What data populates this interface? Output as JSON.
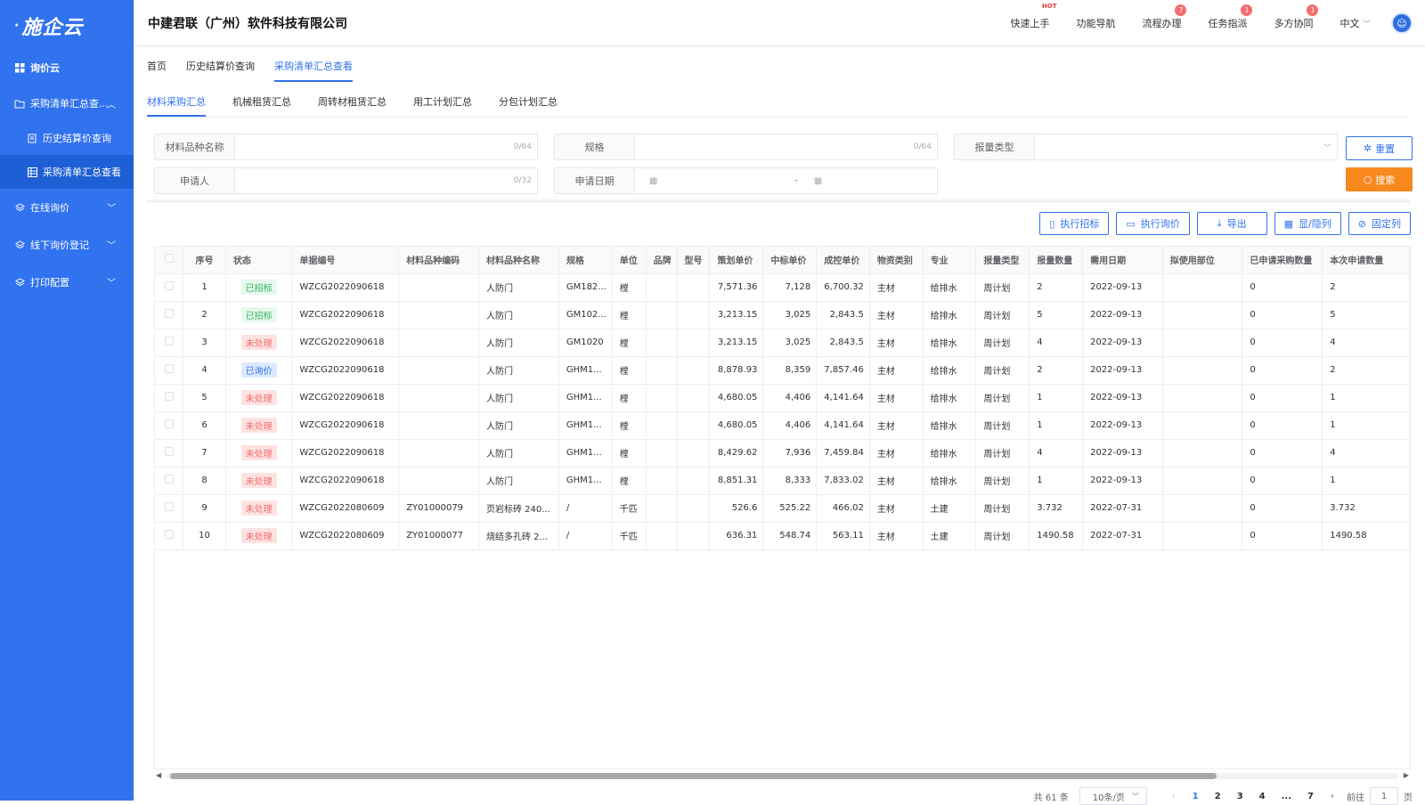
{
  "logo": "施企云",
  "sidebar": {
    "items": [
      {
        "label": "询价云",
        "icon": "grid-icon"
      },
      {
        "label": "采购清单汇总查...",
        "icon": "folder-icon"
      },
      {
        "label": "历史结算价查询",
        "icon": "history-icon"
      },
      {
        "label": "采购清单汇总查看",
        "icon": "table-icon"
      },
      {
        "label": "在线询价",
        "icon": "layers-icon"
      },
      {
        "label": "线下询价登记",
        "icon": "layers-icon"
      },
      {
        "label": "打印配置",
        "icon": "layers-icon"
      }
    ]
  },
  "header": {
    "company": "中建君联（广州）软件科技有限公司",
    "nav": [
      {
        "label": "快速上手",
        "badge": "HOT"
      },
      {
        "label": "功能导航",
        "badge": ""
      },
      {
        "label": "流程办理",
        "badge": "7"
      },
      {
        "label": "任务指派",
        "badge": "1"
      },
      {
        "label": "多方协同",
        "badge": "1"
      }
    ],
    "language": "中文"
  },
  "breadcrumbs": [
    "首页",
    "历史结算价查询",
    "采购清单汇总查看"
  ],
  "subtabs": [
    "材料采购汇总",
    "机械租赁汇总",
    "周转材租赁汇总",
    "用工计划汇总",
    "分包计划汇总"
  ],
  "form": {
    "material_name": {
      "label": "材料品种名称",
      "count": "0/64"
    },
    "spec": {
      "label": "规格",
      "count": "0/64"
    },
    "report_type": {
      "label": "报量类型"
    },
    "applicant": {
      "label": "申请人",
      "count": "0/32"
    },
    "apply_date": {
      "label": "申请日期",
      "sep": "-"
    },
    "reset": "重置",
    "search": "搜索"
  },
  "toolbar": [
    "执行招标",
    "执行询价",
    "导出",
    "显/隐列",
    "固定列"
  ],
  "colors": {
    "primary": "#3172ee",
    "orange": "#f7891f",
    "sidebar": "#3172ee"
  },
  "table": {
    "headers": [
      "序号",
      "状态",
      "单据编号",
      "材料品种编码",
      "材料品种名称",
      "规格",
      "单位",
      "品牌",
      "型号",
      "策划单价",
      "中标单价",
      "成控单价",
      "物资类别",
      "专业",
      "报量类型",
      "报量数量",
      "需用日期",
      "拟使用部位",
      "已申请采购数量",
      "本次申请数量"
    ],
    "rows": [
      [
        "1",
        "已招标",
        "WZCG2022090618",
        "",
        "人防门",
        "GM182...",
        "樘",
        "",
        "",
        "7,571.36",
        "7,128",
        "6,700.32",
        "主材",
        "给排水",
        "周计划",
        "2",
        "2022-09-13",
        "",
        "0",
        "2"
      ],
      [
        "2",
        "已招标",
        "WZCG2022090618",
        "",
        "人防门",
        "GM102...",
        "樘",
        "",
        "",
        "3,213.15",
        "3,025",
        "2,843.5",
        "主材",
        "给排水",
        "周计划",
        "5",
        "2022-09-13",
        "",
        "0",
        "5"
      ],
      [
        "3",
        "未处理",
        "WZCG2022090618",
        "",
        "人防门",
        "GM1020",
        "樘",
        "",
        "",
        "3,213.15",
        "3,025",
        "2,843.5",
        "主材",
        "给排水",
        "周计划",
        "4",
        "2022-09-13",
        "",
        "0",
        "4"
      ],
      [
        "4",
        "已询价",
        "WZCG2022090618",
        "",
        "人防门",
        "GHM1...",
        "樘",
        "",
        "",
        "8,878.93",
        "8,359",
        "7,857.46",
        "主材",
        "给排水",
        "周计划",
        "2",
        "2022-09-13",
        "",
        "0",
        "2"
      ],
      [
        "5",
        "未处理",
        "WZCG2022090618",
        "",
        "人防门",
        "GHM1...",
        "樘",
        "",
        "",
        "4,680.05",
        "4,406",
        "4,141.64",
        "主材",
        "给排水",
        "周计划",
        "1",
        "2022-09-13",
        "",
        "0",
        "1"
      ],
      [
        "6",
        "未处理",
        "WZCG2022090618",
        "",
        "人防门",
        "GHM1...",
        "樘",
        "",
        "",
        "4,680.05",
        "4,406",
        "4,141.64",
        "主材",
        "给排水",
        "周计划",
        "1",
        "2022-09-13",
        "",
        "0",
        "1"
      ],
      [
        "7",
        "未处理",
        "WZCG2022090618",
        "",
        "人防门",
        "GHM1...",
        "樘",
        "",
        "",
        "8,429.62",
        "7,936",
        "7,459.84",
        "主材",
        "给排水",
        "周计划",
        "4",
        "2022-09-13",
        "",
        "0",
        "4"
      ],
      [
        "8",
        "未处理",
        "WZCG2022090618",
        "",
        "人防门",
        "GHM1...",
        "樘",
        "",
        "",
        "8,851.31",
        "8,333",
        "7,833.02",
        "主材",
        "给排水",
        "周计划",
        "1",
        "2022-09-13",
        "",
        "0",
        "1"
      ],
      [
        "9",
        "未处理",
        "WZCG2022080609",
        "ZY01000079",
        "页岩标砖 240...",
        "/",
        "千匹",
        "",
        "",
        "526.6",
        "525.22",
        "466.02",
        "主材",
        "土建",
        "周计划",
        "3.732",
        "2022-07-31",
        "",
        "0",
        "3.732"
      ],
      [
        "10",
        "未处理",
        "WZCG2022080609",
        "ZY01000077",
        "烧结多孔砖 2...",
        "/",
        "千匹",
        "",
        "",
        "636.31",
        "548.74",
        "563.11",
        "主材",
        "土建",
        "周计划",
        "1490.58",
        "2022-07-31",
        "",
        "0",
        "1490.58"
      ]
    ]
  },
  "status_colors": {
    "已招标": {
      "bg": "#e8f8ee",
      "fg": "#30b25c"
    },
    "未处理": {
      "bg": "#fde2e2",
      "fg": "#f56c6c"
    },
    "已询价": {
      "bg": "#dde9ff",
      "fg": "#3172ee"
    }
  },
  "pagination": {
    "total": "共 61 条",
    "page_size": "10条/页",
    "pages": [
      "1",
      "2",
      "3",
      "4",
      "...",
      "7"
    ],
    "current": "1",
    "goto_label": "前往",
    "goto_value": "1",
    "goto_suffix": "页"
  }
}
